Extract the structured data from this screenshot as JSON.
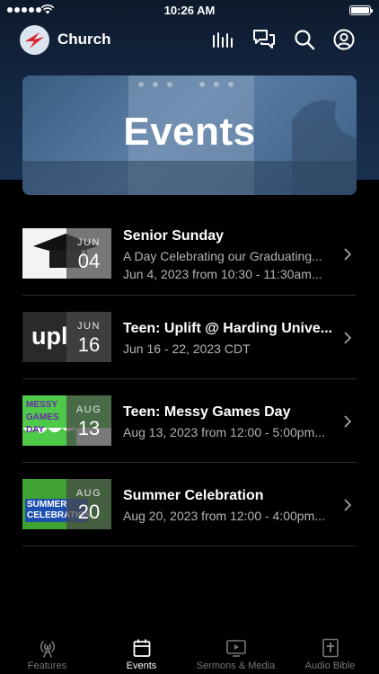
{
  "status_bar": {
    "time": "10:26 AM"
  },
  "header": {
    "title": "Church"
  },
  "hero": {
    "title": "Events"
  },
  "events": [
    {
      "month": "JUN",
      "day": "04",
      "title": "Senior Sunday",
      "subtitle": "A Day Celebrating our Graduating...",
      "date_text": "Jun 4, 2023 from 10:30 - 11:30am..."
    },
    {
      "month": "JUN",
      "day": "16",
      "title": "Teen: Uplift @ Harding Unive...",
      "date_text": "Jun 16 - 22, 2023 CDT",
      "thumb_text": "upl"
    },
    {
      "month": "AUG",
      "day": "13",
      "title": "Teen: Messy Games Day",
      "date_text": "Aug 13, 2023 from 12:00 - 5:00pm...",
      "thumb_text": "MESSY GAMES DAY"
    },
    {
      "month": "AUG",
      "day": "20",
      "title": "Summer Celebration",
      "date_text": "Aug 20, 2023 from 12:00 - 4:00pm...",
      "thumb_text": "SUMMER CELEBRATION"
    }
  ],
  "tabs": [
    {
      "label": "Features",
      "icon": "broadcast-icon",
      "active": false
    },
    {
      "label": "Events",
      "icon": "calendar-icon",
      "active": true
    },
    {
      "label": "Sermons & Media",
      "icon": "play-screen-icon",
      "active": false
    },
    {
      "label": "Audio Bible",
      "icon": "bible-icon",
      "active": false
    }
  ],
  "colors": {
    "background": "#000000",
    "header_bg": "#142844",
    "secondary_text": "#b4b4b4",
    "inactive_tab": "#777777",
    "summer_green": "#3fa332",
    "messy_purple": "#6a2aa8"
  }
}
